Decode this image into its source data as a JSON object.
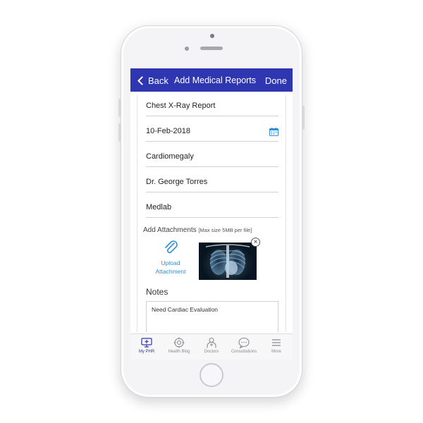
{
  "nav": {
    "back_label": "Back",
    "title": "Add Medical Reports",
    "done_label": "Done"
  },
  "form": {
    "report_name": "Chest X-Ray Report",
    "report_date": "10-Feb-2018",
    "condition": "Cardiomegaly",
    "doctor": "Dr. George Torres",
    "lab": "Medlab",
    "attachments_label": "Add Attachments",
    "attachments_hint": "[Max size 5MB per file]",
    "upload_label_line1": "Upload",
    "upload_label_line2": "Attachment",
    "notes_label": "Notes",
    "notes_value": "Need Cardiac Evaluation"
  },
  "tabs": [
    {
      "label": "My PHR",
      "icon": "monitor-icon",
      "active": true
    },
    {
      "label": "Health Blog",
      "icon": "crosshair-icon",
      "active": false
    },
    {
      "label": "Doctors",
      "icon": "doctor-icon",
      "active": false
    },
    {
      "label": "Consultations",
      "icon": "chat-icon",
      "active": false
    },
    {
      "label": "More",
      "icon": "menu-icon",
      "active": false
    }
  ],
  "colors": {
    "navbar": "#2f36b1",
    "accent_link": "#2e8fd8",
    "active_tab": "#2f36b1"
  }
}
